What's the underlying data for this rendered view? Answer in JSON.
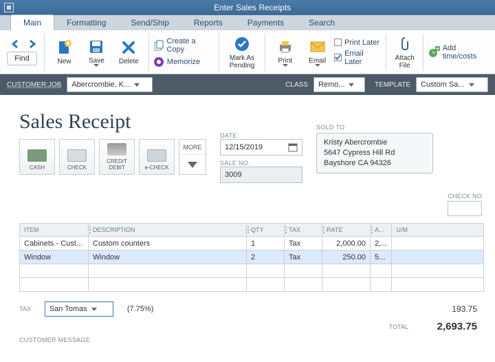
{
  "window": {
    "title": "Enter Sales Receipts"
  },
  "tabs": [
    "Main",
    "Formatting",
    "Send/Ship",
    "Reports",
    "Payments",
    "Search"
  ],
  "ribbon": {
    "find": "Find",
    "new": "New",
    "save": "Save",
    "delete": "Delete",
    "create_copy": "Create a Copy",
    "memorize": "Memorize",
    "mark_pending": "Mark As Pending",
    "print": "Print",
    "email": "Email",
    "print_later": "Print Later",
    "email_later": "Email Later",
    "attach_file": "Attach File",
    "add_time": "Add time/costs"
  },
  "darkbar": {
    "cust_lbl": "CUSTOMER:JOB",
    "cust_val": "Abercrombie, K...",
    "class_lbl": "CLASS",
    "class_val": "Remo...",
    "template_lbl": "TEMPLATE",
    "template_val": "Custom Sa..."
  },
  "form": {
    "title": "Sales Receipt",
    "pay": {
      "cash": "CASH",
      "check": "CHECK",
      "credit": "CREDIT DEBIT",
      "echeck": "e-CHECK",
      "more": "MORE"
    },
    "date_lbl": "DATE",
    "date_val": "12/15/2019",
    "sale_lbl": "SALE NO.",
    "sale_val": "3009",
    "sold_lbl": "SOLD TO",
    "sold_to": [
      "Kristy Abercrombie",
      "5647 Cypress Hill Rd",
      "Bayshore CA 94326"
    ],
    "check_lbl": "CHECK NO."
  },
  "table": {
    "headers": [
      "ITEM",
      "DESCRIPTION",
      "QTY",
      "TAX",
      "RATE",
      "A...",
      "U/M"
    ],
    "rows": [
      {
        "item": "Cabinets - Cust...",
        "desc": "Custom counters",
        "qty": "1",
        "tax": "Tax",
        "rate": "2,000.00",
        "amt": "2,..."
      },
      {
        "item": "Window",
        "desc": "Window",
        "qty": "2",
        "tax": "Tax",
        "rate": "250.00",
        "amt": "5..."
      }
    ]
  },
  "totals": {
    "tax_lbl": "TAX",
    "tax_name": "San Tomas",
    "tax_pct": "(7.75%)",
    "tax_amt": "193.75",
    "total_lbl": "TOTAL",
    "total_amt": "2,693.75",
    "cust_msg": "CUSTOMER MESSAGE"
  }
}
